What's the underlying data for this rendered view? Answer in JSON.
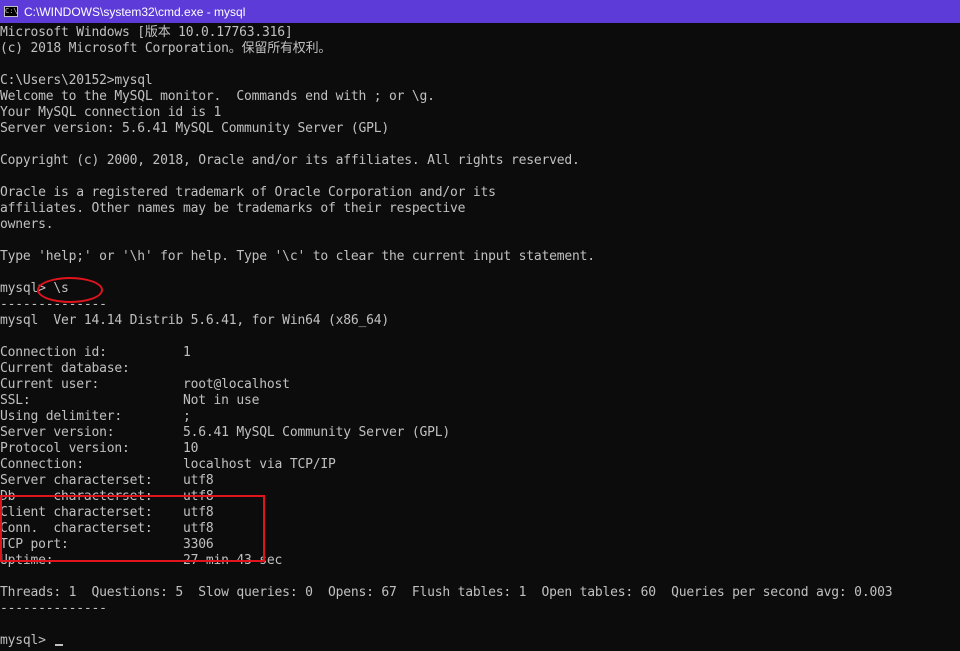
{
  "window": {
    "title": "C:\\WINDOWS\\system32\\cmd.exe - mysql",
    "icon": "cmd-icon",
    "colors": {
      "titlebar": "#5c3bd8",
      "background": "#0c0c0c",
      "text": "#c0c0c0",
      "annotation": "#e0141c"
    }
  },
  "console": {
    "lines": [
      "Microsoft Windows [版本 10.0.17763.316]",
      "(c) 2018 Microsoft Corporation。保留所有权利。",
      "",
      "C:\\Users\\20152>mysql",
      "Welcome to the MySQL monitor.  Commands end with ; or \\g.",
      "Your MySQL connection id is 1",
      "Server version: 5.6.41 MySQL Community Server (GPL)",
      "",
      "Copyright (c) 2000, 2018, Oracle and/or its affiliates. All rights reserved.",
      "",
      "Oracle is a registered trademark of Oracle Corporation and/or its",
      "affiliates. Other names may be trademarks of their respective",
      "owners.",
      "",
      "Type 'help;' or '\\h' for help. Type '\\c' to clear the current input statement.",
      "",
      "mysql> \\s",
      "--------------",
      "mysql  Ver 14.14 Distrib 5.6.41, for Win64 (x86_64)",
      "",
      "Connection id:          1",
      "Current database:",
      "Current user:           root@localhost",
      "SSL:                    Not in use",
      "Using delimiter:        ;",
      "Server version:         5.6.41 MySQL Community Server (GPL)",
      "Protocol version:       10",
      "Connection:             localhost via TCP/IP",
      "Server characterset:    utf8",
      "Db     characterset:    utf8",
      "Client characterset:    utf8",
      "Conn.  characterset:    utf8",
      "TCP port:               3306",
      "Uptime:                 27 min 43 sec",
      "",
      "Threads: 1  Questions: 5  Slow queries: 0  Opens: 67  Flush tables: 1  Open tables: 60  Queries per second avg: 0.003",
      "--------------",
      "",
      "mysql> "
    ]
  }
}
